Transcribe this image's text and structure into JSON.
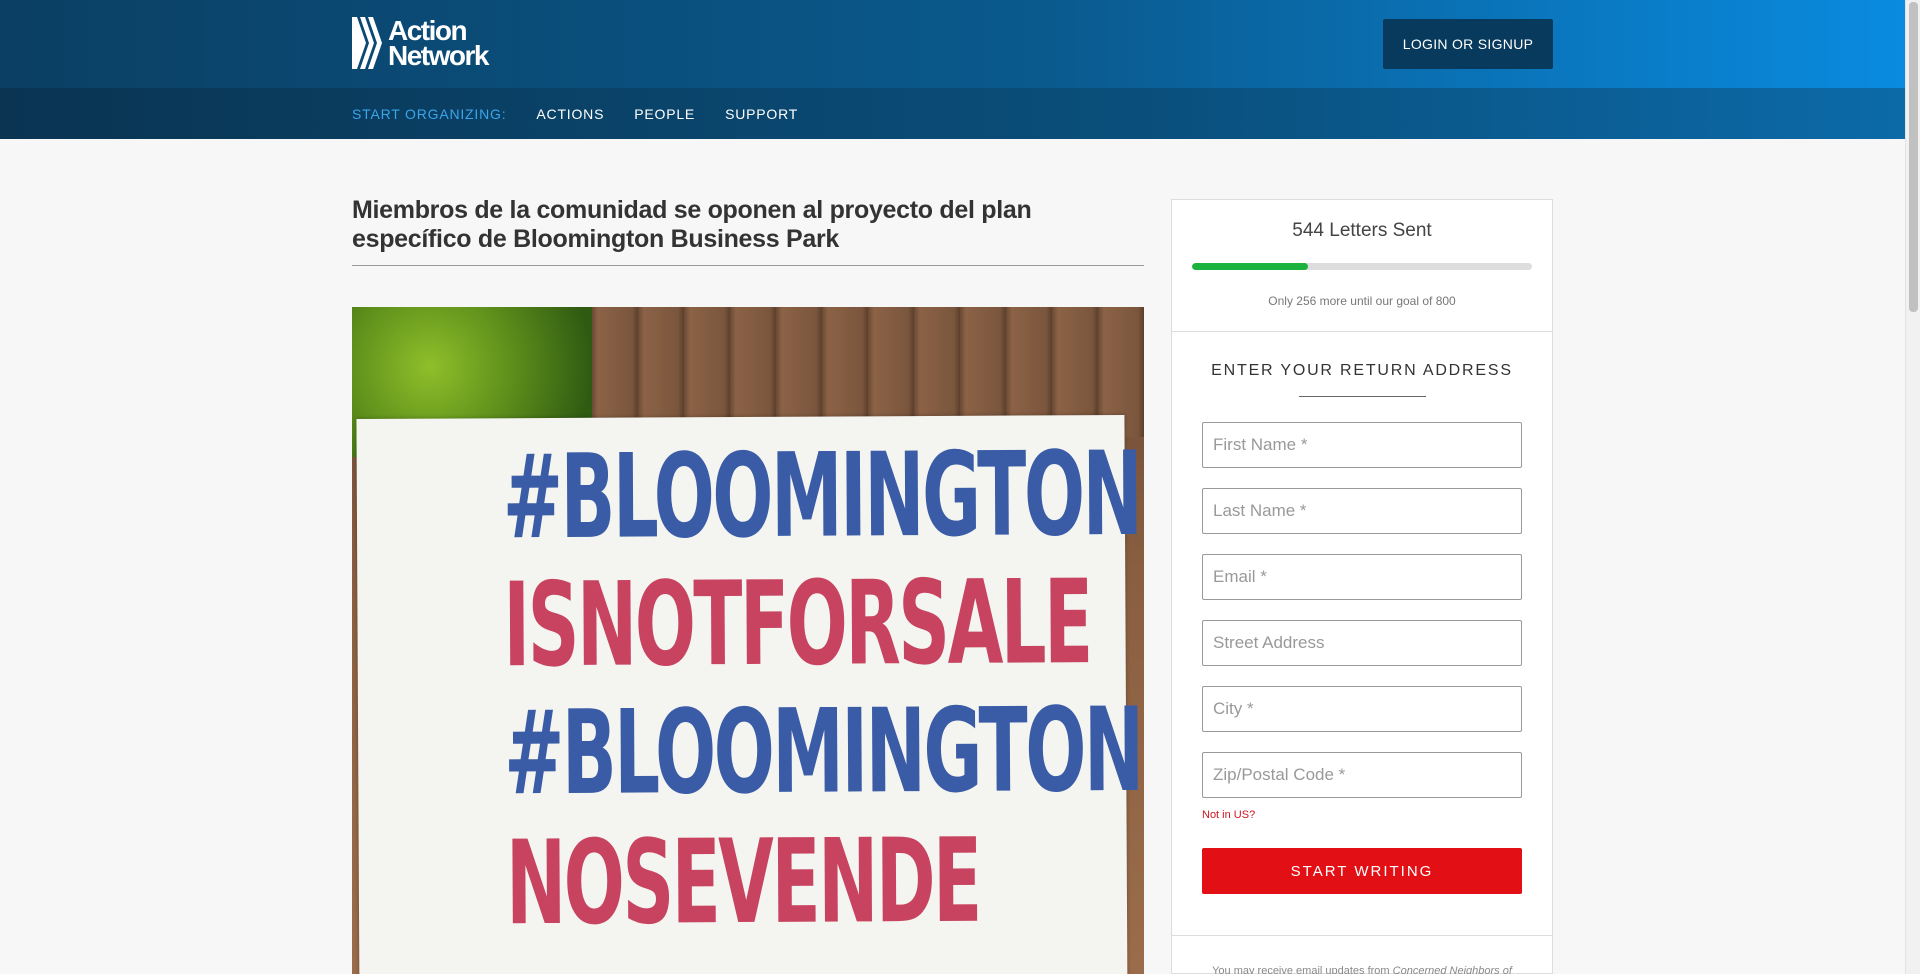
{
  "header": {
    "logo_line1": "Action",
    "logo_line2": "Network",
    "login_label": "LOGIN OR SIGNUP"
  },
  "nav": {
    "label": "START ORGANIZING:",
    "links": [
      "ACTIONS",
      "PEOPLE",
      "SUPPORT"
    ]
  },
  "main": {
    "title": "Miembros de la comunidad se oponen al proyecto del plan específico de Bloomington Business Park",
    "image_text": [
      "#BLOOMINGTON",
      "ISNOTFORSALE",
      "#BLOOMINGTON",
      "NOSEVENDE"
    ]
  },
  "progress": {
    "letters_sent": "544 Letters Sent",
    "fraction": 0.34,
    "goal_text": "Only 256 more until our goal of 800"
  },
  "form": {
    "heading": "ENTER YOUR RETURN ADDRESS",
    "fields": {
      "first_name": "First Name *",
      "last_name": "Last Name *",
      "email": "Email *",
      "street": "Street Address",
      "city": "City *",
      "zip": "Zip/Postal Code *"
    },
    "not_us": "Not in US?",
    "submit_label": "START WRITING",
    "disclaimer_prefix": "You may receive email updates from",
    "disclaimer_org": "Concerned Neighbors of"
  },
  "colors": {
    "submit": "#e20f15",
    "progress": "#1bb23e",
    "nav_label": "#3aa5ea",
    "login_bg": "#073a5c"
  }
}
